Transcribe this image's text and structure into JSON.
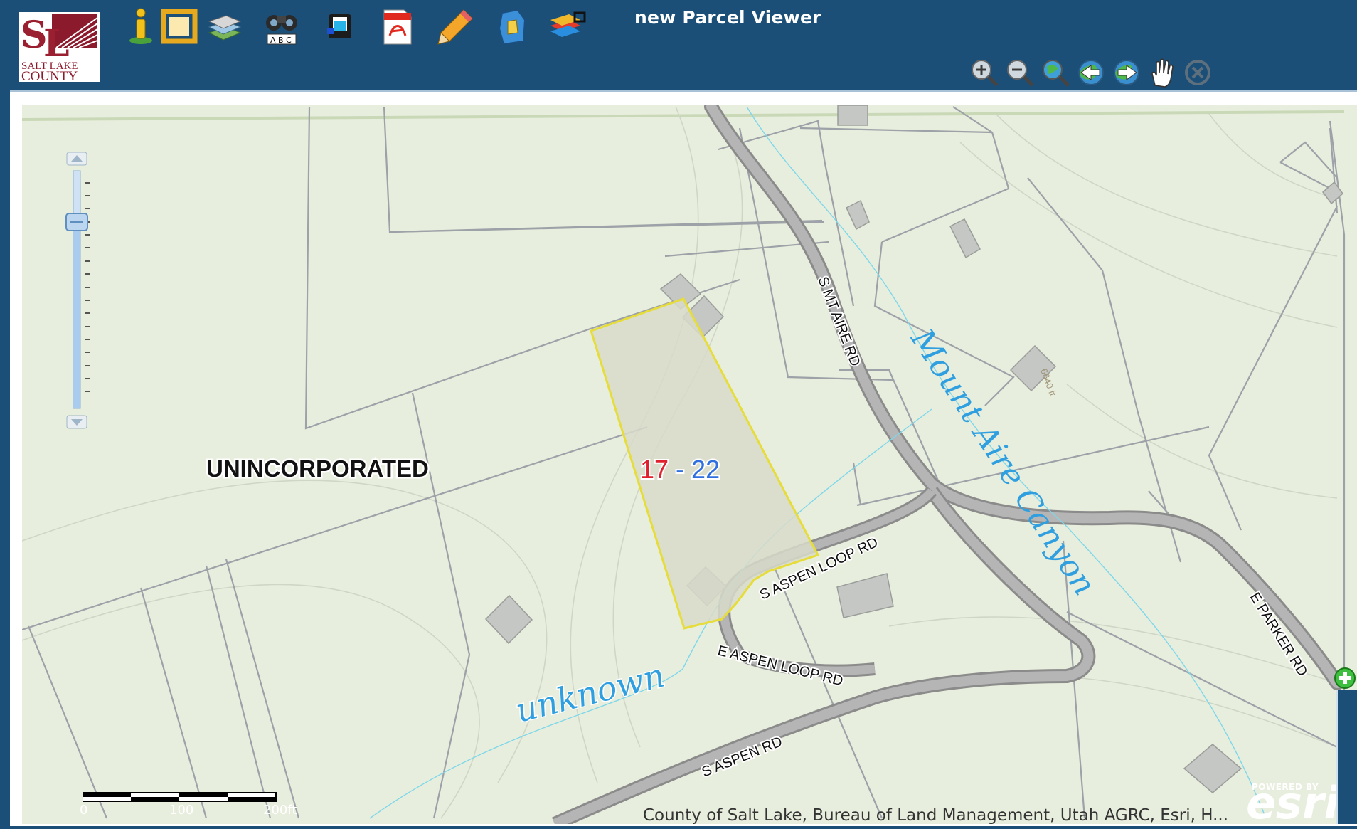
{
  "app": {
    "title": "new Parcel Viewer",
    "logo_text": [
      "SALT LAKE",
      "COUNTY"
    ]
  },
  "toolbar": {
    "icons": [
      "identify-icon",
      "map-frame-icon",
      "layers-icon",
      "binoculars-search-icon",
      "print-icon",
      "pdf-icon",
      "pencil-draw-icon",
      "parcel-shape-icon",
      "basemap-icon"
    ]
  },
  "navigation": {
    "icons": [
      "zoom-in-icon",
      "zoom-out-icon",
      "full-extent-icon",
      "previous-extent-icon",
      "next-extent-icon",
      "pan-hand-icon",
      "deactivate-icon"
    ]
  },
  "map": {
    "labels": {
      "region": "UNINCORPORATED",
      "parcel_part1": "17",
      "parcel_sep": " - ",
      "parcel_part2": "22",
      "canyon": "Mount Aire Canyon",
      "stream": "unknown",
      "road_mt_aire": "S MT AIRE RD",
      "road_aspen_loop_s": "S ASPEN LOOP RD",
      "road_aspen_loop_e": "E ASPEN LOOP RD",
      "road_aspen": "S ASPEN RD",
      "road_parker": "E PARKER RD",
      "elevation": "6640 ft"
    },
    "attribution": "County of Salt Lake, Bureau of Land Management, Utah AGRC, Esri, H...",
    "esri_powered": "POWERED BY",
    "esri_brand": "esri",
    "scalebar": {
      "labels": [
        "0",
        "100",
        "200ft"
      ]
    },
    "colors": {
      "background": "#e8eedd",
      "parcel_outline": "#e6dc3a",
      "parcel_fill": "#d8dbc9",
      "water_label": "#2f9fe0",
      "road": "#a6a6a6",
      "parcel_num_red": "#e0202e",
      "parcel_num_blue": "#2f6fe0"
    }
  }
}
